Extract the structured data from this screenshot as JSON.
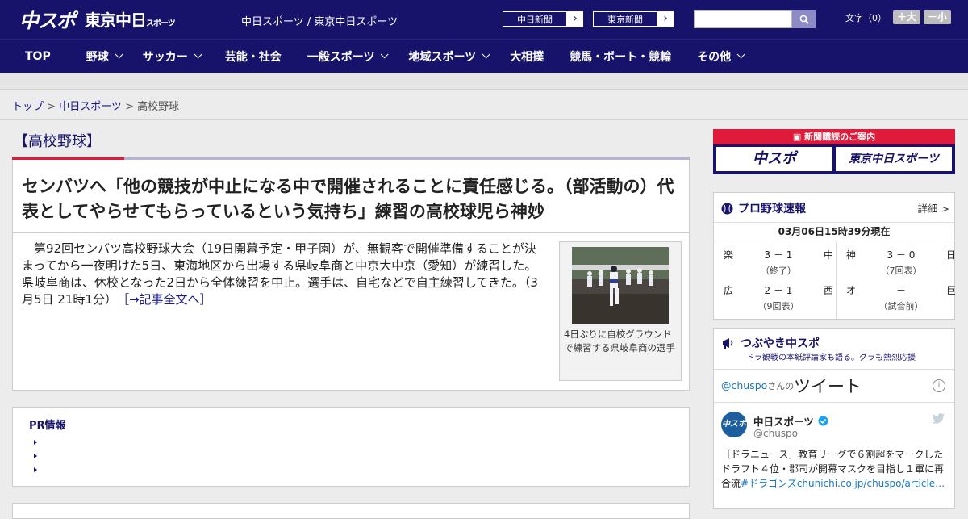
{
  "header": {
    "logo_chuspo": "中スポ",
    "logo_tokyo": "東京中日",
    "logo_sports": "スポーツ",
    "site_links": "中日スポーツ / 東京中日スポーツ",
    "paper_buttons": [
      "中日新聞",
      "東京新聞"
    ],
    "search_placeholder": "",
    "font_label": "文字（0）",
    "font_large": "＋大",
    "font_small": "－小"
  },
  "nav": [
    {
      "label": "TOP",
      "dropdown": false
    },
    {
      "label": "野球",
      "dropdown": true
    },
    {
      "label": "サッカー",
      "dropdown": true
    },
    {
      "label": "芸能・社会",
      "dropdown": false
    },
    {
      "label": "一般スポーツ",
      "dropdown": true
    },
    {
      "label": "地域スポーツ",
      "dropdown": true
    },
    {
      "label": "大相撲",
      "dropdown": false
    },
    {
      "label": "競馬・ボート・競輪",
      "dropdown": false
    },
    {
      "label": "その他",
      "dropdown": true
    }
  ],
  "breadcrumb": {
    "top": "トップ",
    "sep": " > ",
    "section": "中日スポーツ",
    "current": "高校野球"
  },
  "article": {
    "category": "【高校野球】",
    "headline": "センバツへ「他の競技が中止になる中で開催されることに責任感じる。（部活動の）代表としてやらせてもらっているという気持ち」練習の高校球児ら神妙",
    "body": "第92回センバツ高校野球大会（19日開幕予定・甲子園）が、無観客で開催準備することが決まってから一夜明けた5日、東海地区から出場する県岐阜商と中京大中京（愛知）が練習した。県岐阜商は、休校となった2日から全体練習を中止。選手は、自宅などで自主練習してきた。（3月5日 21時1分）",
    "read_more": "［→記事全文へ］",
    "photo_caption": "4日ぶりに自校グラウンドで練習する県岐阜商の選手"
  },
  "pr": {
    "title": "PR情報"
  },
  "sidebar": {
    "promo_banner": "新聞購読のご案内",
    "promo_buttons": [
      "中スポ",
      "東京中日スポーツ"
    ],
    "pro_baseball": {
      "title": "プロ野球速報",
      "more": "詳細 >",
      "time": "03月06日15時39分現在",
      "games": [
        {
          "home": "楽",
          "score": "3 － 1",
          "away": "中",
          "status": "（終了）"
        },
        {
          "home": "神",
          "score": "3 － 0",
          "away": "日",
          "status": "（7回表）"
        },
        {
          "home": "広",
          "score": "2 － 1",
          "away": "西",
          "status": "（9回表）"
        },
        {
          "home": "オ",
          "score": "－",
          "away": "巨",
          "status": "（試合前）"
        }
      ]
    },
    "tweets": {
      "title": "つぶやき中スポ",
      "subtitle": "ドラ観戦の本紙評論家も語る。グラも熱烈応援",
      "handle": "@chuspo",
      "handle_suffix": "さんの",
      "heading": "ツイート",
      "account_name": "中日スポーツ",
      "account_handle": "@chuspo",
      "avatar_text": "中スポ",
      "tweet_text": "［ドラニュース］教育リーグで６割超をマークしたドラフト４位・郡司が開幕マスクを目指し１軍に再合流",
      "tweet_link": "#ドラゴンズchunichi.co.jp/chuspo/article…"
    }
  },
  "colors": {
    "brand_navy": "#17136b",
    "accent_red": "#e01a3a",
    "link": "#1a1a8c"
  }
}
